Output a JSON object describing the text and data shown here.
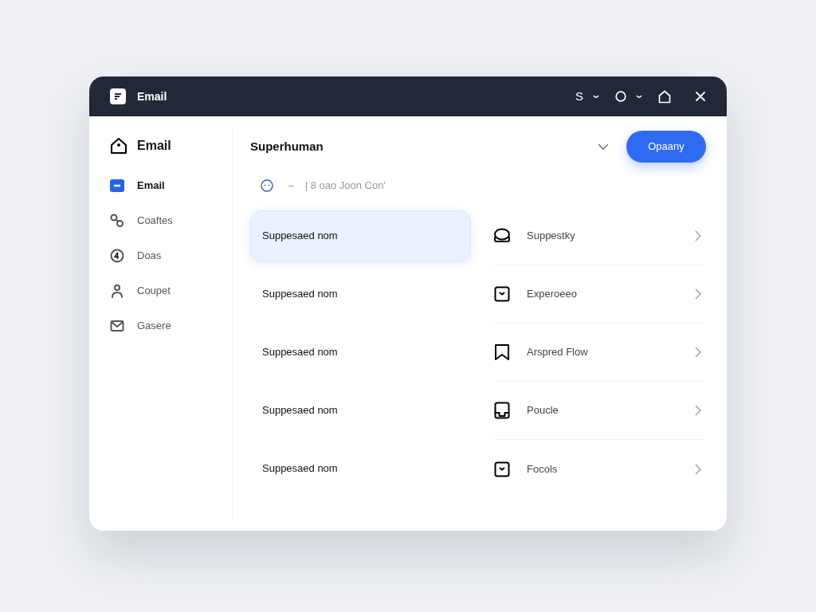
{
  "window": {
    "title": "Email",
    "title_text": "S"
  },
  "sidebar": {
    "header": "Email",
    "items": [
      {
        "label": "Email",
        "selected": true
      },
      {
        "label": "Coaftes",
        "selected": false
      },
      {
        "label": "Doas",
        "selected": false
      },
      {
        "label": "Coupet",
        "selected": false
      },
      {
        "label": "Gasere",
        "selected": false
      }
    ]
  },
  "main": {
    "title": "Superhuman",
    "button": "Opaany",
    "search": {
      "dash": "–",
      "placeholder": "| 8 oao Joon Con'"
    },
    "left_rows": [
      {
        "label": "Suppesaed nom",
        "selected": true
      },
      {
        "label": "Suppesaed nom",
        "selected": false
      },
      {
        "label": "Suppesaed nom",
        "selected": false
      },
      {
        "label": "Suppesaed nom",
        "selected": false
      },
      {
        "label": "Suppesaed nom",
        "selected": false
      }
    ],
    "right_rows": [
      {
        "label": "Suppestky"
      },
      {
        "label": "Experoeeo"
      },
      {
        "label": "Arspred Flow"
      },
      {
        "label": "Poucle"
      },
      {
        "label": "Focols"
      }
    ]
  }
}
